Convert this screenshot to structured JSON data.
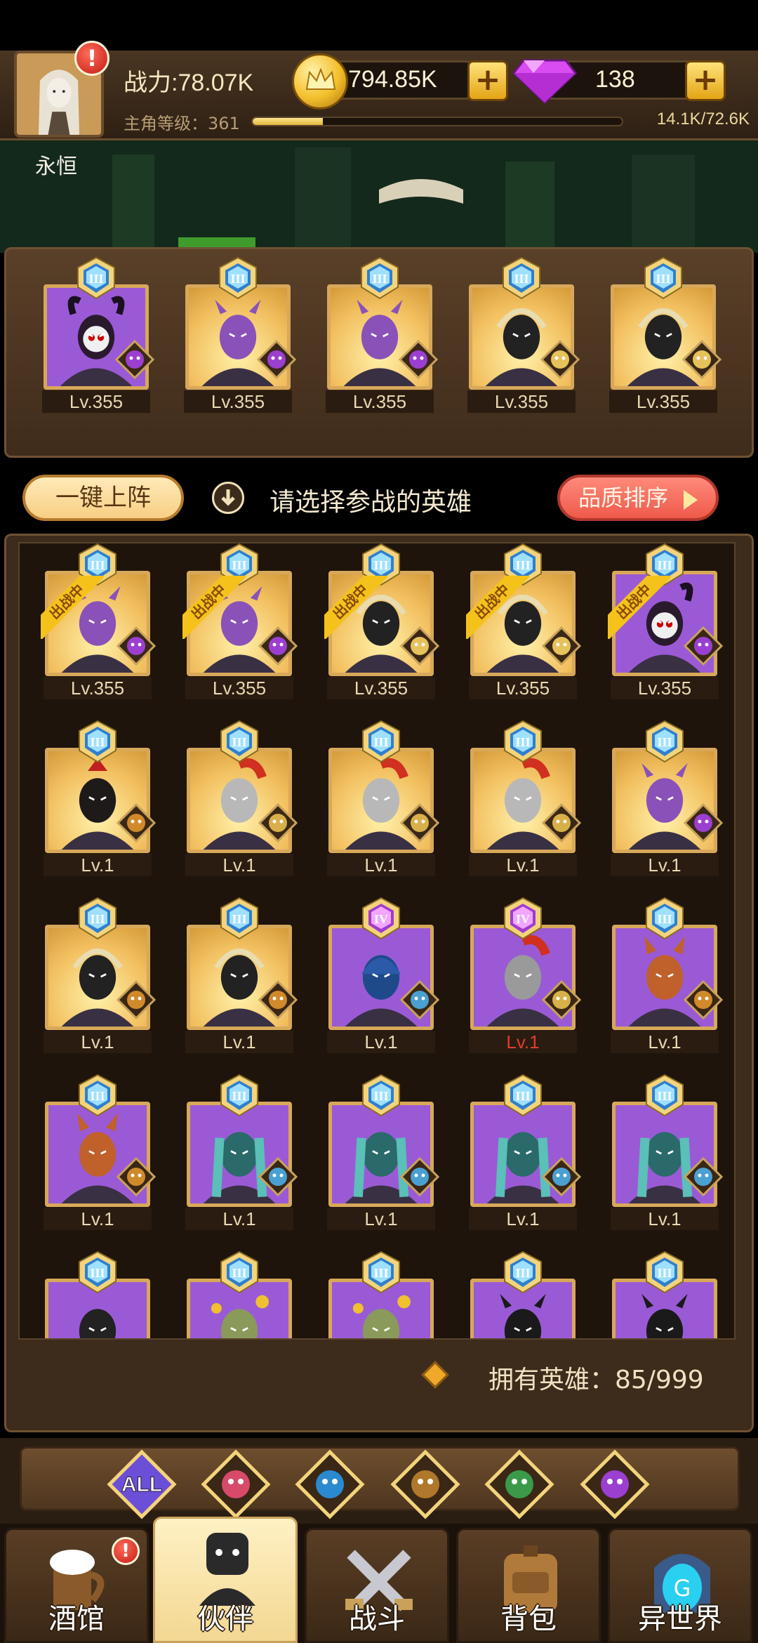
{
  "player": {
    "power": "战力:78.07K",
    "level_label": "主角等级：361",
    "exp_text": "14.1K/72.6K",
    "exp_progress": 0.19,
    "name": "永恒",
    "alert": "!"
  },
  "currency": {
    "gold": "794.85K",
    "gems": "138",
    "plus": "+"
  },
  "team": [
    {
      "level": "Lv.355",
      "rank": "III",
      "bg": "purple",
      "hero": "demon-skull",
      "faction": "demon"
    },
    {
      "level": "Lv.355",
      "rank": "III",
      "bg": "gold",
      "hero": "orc-purple",
      "faction": "demon"
    },
    {
      "level": "Lv.355",
      "rank": "III",
      "bg": "gold",
      "hero": "orc-purple",
      "faction": "demon"
    },
    {
      "level": "Lv.355",
      "rank": "III",
      "bg": "gold",
      "hero": "elf-hood",
      "faction": "elf"
    },
    {
      "level": "Lv.355",
      "rank": "III",
      "bg": "gold",
      "hero": "elf-hood",
      "faction": "elf"
    }
  ],
  "actions": {
    "one_key": "一键上阵",
    "hint": "请选择参战的英雄",
    "sort": "品质排序",
    "deployed": "出战中"
  },
  "roster": [
    {
      "level": "Lv.355",
      "rank": "III",
      "bg": "gold",
      "hero": "orc-purple",
      "faction": "demon",
      "deployed": true
    },
    {
      "level": "Lv.355",
      "rank": "III",
      "bg": "gold",
      "hero": "orc-purple",
      "faction": "demon",
      "deployed": true
    },
    {
      "level": "Lv.355",
      "rank": "III",
      "bg": "gold",
      "hero": "elf-hood",
      "faction": "elf",
      "deployed": true
    },
    {
      "level": "Lv.355",
      "rank": "III",
      "bg": "gold",
      "hero": "elf-hood",
      "faction": "elf",
      "deployed": true
    },
    {
      "level": "Lv.355",
      "rank": "III",
      "bg": "purple",
      "hero": "demon-skull",
      "faction": "demon",
      "deployed": true
    },
    {
      "level": "Lv.1",
      "rank": "III",
      "bg": "gold",
      "hero": "red-warrior",
      "faction": "beast"
    },
    {
      "level": "Lv.1",
      "rank": "III",
      "bg": "gold",
      "hero": "knight",
      "faction": "human"
    },
    {
      "level": "Lv.1",
      "rank": "III",
      "bg": "gold",
      "hero": "knight",
      "faction": "human"
    },
    {
      "level": "Lv.1",
      "rank": "III",
      "bg": "gold",
      "hero": "knight",
      "faction": "human"
    },
    {
      "level": "Lv.1",
      "rank": "III",
      "bg": "gold",
      "hero": "orc-purple",
      "faction": "demon"
    },
    {
      "level": "Lv.1",
      "rank": "III",
      "bg": "gold",
      "hero": "pharaoh",
      "faction": "beast"
    },
    {
      "level": "Lv.1",
      "rank": "III",
      "bg": "gold",
      "hero": "pharaoh",
      "faction": "beast"
    },
    {
      "level": "Lv.1",
      "rank": "IV",
      "bg": "purple",
      "hero": "blue-hood",
      "faction": "fish"
    },
    {
      "level": "Lv.1",
      "rank": "IV",
      "bg": "purple",
      "hero": "spartan",
      "faction": "human",
      "red": true
    },
    {
      "level": "Lv.1",
      "rank": "III",
      "bg": "purple",
      "hero": "fox",
      "faction": "beast"
    },
    {
      "level": "Lv.1",
      "rank": "III",
      "bg": "purple",
      "hero": "fox",
      "faction": "beast"
    },
    {
      "level": "Lv.1",
      "rank": "III",
      "bg": "purple",
      "hero": "teal-hair",
      "faction": "fish"
    },
    {
      "level": "Lv.1",
      "rank": "III",
      "bg": "purple",
      "hero": "teal-hair",
      "faction": "fish"
    },
    {
      "level": "Lv.1",
      "rank": "III",
      "bg": "purple",
      "hero": "teal-hair",
      "faction": "fish"
    },
    {
      "level": "Lv.1",
      "rank": "III",
      "bg": "purple",
      "hero": "teal-hair",
      "faction": "fish"
    },
    {
      "level": "",
      "rank": "III",
      "bg": "purple",
      "hero": "dark",
      "faction": ""
    },
    {
      "level": "",
      "rank": "III",
      "bg": "purple",
      "hero": "flower",
      "faction": ""
    },
    {
      "level": "",
      "rank": "III",
      "bg": "purple",
      "hero": "flower",
      "faction": ""
    },
    {
      "level": "",
      "rank": "III",
      "bg": "purple",
      "hero": "horns",
      "faction": ""
    },
    {
      "level": "",
      "rank": "III",
      "bg": "purple",
      "hero": "horns",
      "faction": ""
    }
  ],
  "owned": "拥有英雄：85/999",
  "filters": [
    {
      "label": "ALL",
      "icon": "all-filter-icon"
    },
    {
      "label": "",
      "icon": "human-faction-icon"
    },
    {
      "label": "",
      "icon": "fish-faction-icon"
    },
    {
      "label": "",
      "icon": "beast-faction-icon"
    },
    {
      "label": "",
      "icon": "elf-faction-icon"
    },
    {
      "label": "",
      "icon": "demon-faction-icon"
    }
  ],
  "nav": [
    {
      "label": "酒馆",
      "icon": "tavern-icon",
      "badge": "!"
    },
    {
      "label": "伙伴",
      "icon": "partner-icon",
      "active": true
    },
    {
      "label": "战斗",
      "icon": "battle-icon"
    },
    {
      "label": "背包",
      "icon": "backpack-icon"
    },
    {
      "label": "异世界",
      "icon": "otherworld-icon"
    }
  ],
  "colors": {
    "gold_bg": "#f2c060",
    "purple_bg": "#9a5ad6",
    "frame": "#d8a85a",
    "accent_red": "#ee5a4a"
  }
}
